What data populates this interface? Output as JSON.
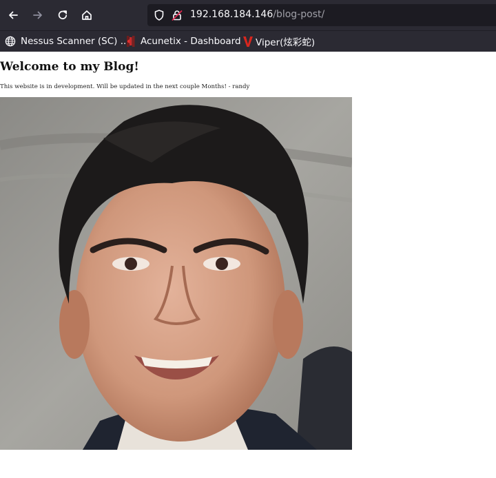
{
  "browser": {
    "url_host": "192.168.184.146",
    "url_path": "/blog-post/",
    "nav_icons": [
      "back-arrow-icon",
      "forward-arrow-icon",
      "reload-icon",
      "home-icon"
    ],
    "url_icons": [
      "shield-icon",
      "insecure-lock-icon"
    ],
    "colors": {
      "chrome": "#2b2a33",
      "urlbar": "#1c1b22",
      "text": "#fbfbfe"
    }
  },
  "bookmarks": [
    {
      "label": "Nessus Scanner (SC) ...",
      "icon": "globe-icon"
    },
    {
      "label": "Acunetix - Dashboard",
      "icon": "acunetix-icon"
    },
    {
      "label": "Viper(炫彩蛇)",
      "icon": "viper-icon"
    }
  ],
  "page": {
    "title": "Welcome to my Blog!",
    "subtitle": "This website is in development. Will be updated in the next couple Months! - randy",
    "image_subject": "portrait-photo"
  }
}
